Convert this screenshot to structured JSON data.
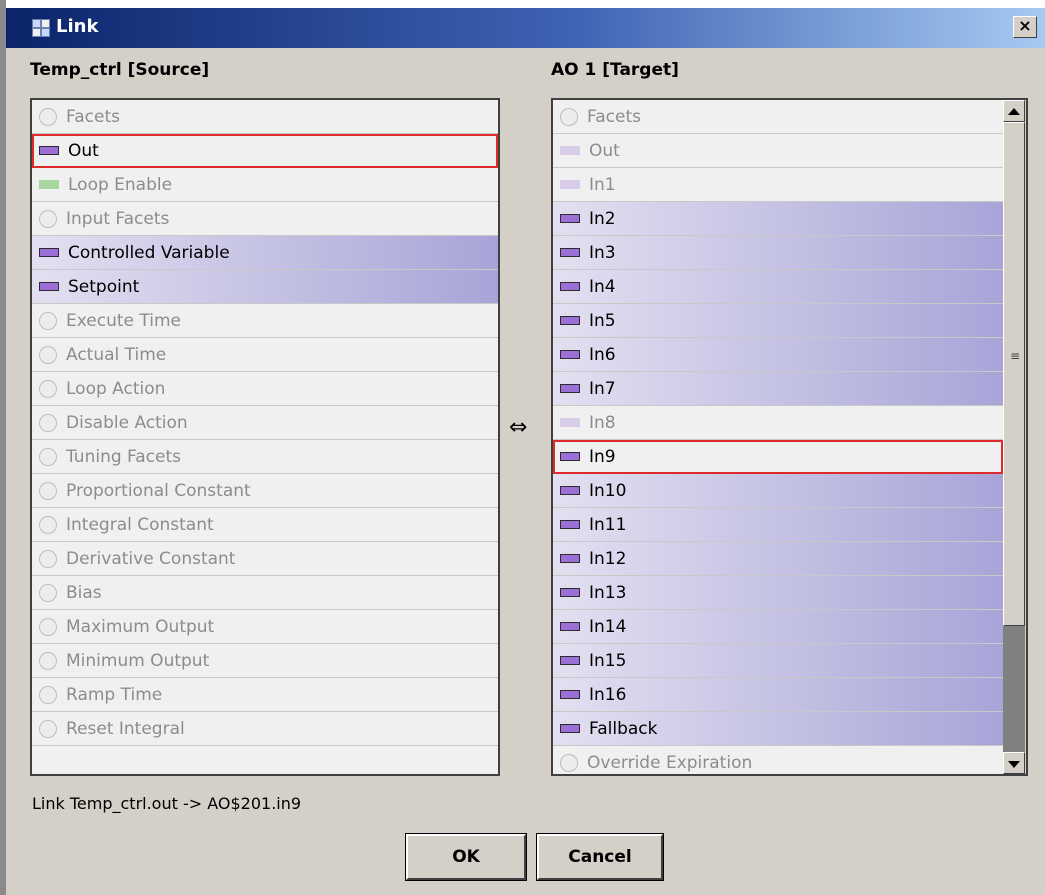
{
  "window": {
    "title": "Link",
    "close_label": "×"
  },
  "source": {
    "header": "Temp_ctrl [Source]",
    "items": [
      {
        "label": "Facets",
        "icon": "circle",
        "state": "disabled"
      },
      {
        "label": "Out",
        "icon": "slot",
        "state": "selected"
      },
      {
        "label": "Loop Enable",
        "icon": "slot-green",
        "state": "disabled"
      },
      {
        "label": "Input Facets",
        "icon": "circle",
        "state": "disabled"
      },
      {
        "label": "Controlled Variable",
        "icon": "slot",
        "state": "linkable"
      },
      {
        "label": "Setpoint",
        "icon": "slot",
        "state": "linkable"
      },
      {
        "label": "Execute Time",
        "icon": "circle",
        "state": "disabled"
      },
      {
        "label": "Actual Time",
        "icon": "circle",
        "state": "disabled"
      },
      {
        "label": "Loop Action",
        "icon": "circle",
        "state": "disabled"
      },
      {
        "label": "Disable Action",
        "icon": "circle",
        "state": "disabled"
      },
      {
        "label": "Tuning Facets",
        "icon": "circle",
        "state": "disabled"
      },
      {
        "label": "Proportional Constant",
        "icon": "circle",
        "state": "disabled"
      },
      {
        "label": "Integral Constant",
        "icon": "circle",
        "state": "disabled"
      },
      {
        "label": "Derivative Constant",
        "icon": "circle",
        "state": "disabled"
      },
      {
        "label": "Bias",
        "icon": "circle",
        "state": "disabled"
      },
      {
        "label": "Maximum Output",
        "icon": "circle",
        "state": "disabled"
      },
      {
        "label": "Minimum Output",
        "icon": "circle",
        "state": "disabled"
      },
      {
        "label": "Ramp Time",
        "icon": "circle",
        "state": "disabled"
      },
      {
        "label": "Reset Integral",
        "icon": "circle",
        "state": "disabled"
      }
    ]
  },
  "target": {
    "header": "AO 1 [Target]",
    "items": [
      {
        "label": "Facets",
        "icon": "circle",
        "state": "disabled"
      },
      {
        "label": "Out",
        "icon": "slot-dim",
        "state": "disabled"
      },
      {
        "label": "In1",
        "icon": "slot-dim",
        "state": "disabled"
      },
      {
        "label": "In2",
        "icon": "slot",
        "state": "linkable"
      },
      {
        "label": "In3",
        "icon": "slot",
        "state": "linkable"
      },
      {
        "label": "In4",
        "icon": "slot",
        "state": "linkable"
      },
      {
        "label": "In5",
        "icon": "slot",
        "state": "linkable"
      },
      {
        "label": "In6",
        "icon": "slot",
        "state": "linkable"
      },
      {
        "label": "In7",
        "icon": "slot",
        "state": "linkable"
      },
      {
        "label": "In8",
        "icon": "slot-dim",
        "state": "disabled"
      },
      {
        "label": "In9",
        "icon": "slot",
        "state": "selected"
      },
      {
        "label": "In10",
        "icon": "slot",
        "state": "linkable"
      },
      {
        "label": "In11",
        "icon": "slot",
        "state": "linkable"
      },
      {
        "label": "In12",
        "icon": "slot",
        "state": "linkable"
      },
      {
        "label": "In13",
        "icon": "slot",
        "state": "linkable"
      },
      {
        "label": "In14",
        "icon": "slot",
        "state": "linkable"
      },
      {
        "label": "In15",
        "icon": "slot",
        "state": "linkable"
      },
      {
        "label": "In16",
        "icon": "slot",
        "state": "linkable"
      },
      {
        "label": "Fallback",
        "icon": "slot",
        "state": "linkable"
      },
      {
        "label": "Override Expiration",
        "icon": "circle",
        "state": "disabled"
      }
    ]
  },
  "link_arrow": "⇔",
  "status": "Link Temp_ctrl.out -> AO$201.in9",
  "buttons": {
    "ok": "OK",
    "cancel": "Cancel"
  },
  "scrollbar": {
    "position": 0,
    "visible_fraction": 0.8
  }
}
